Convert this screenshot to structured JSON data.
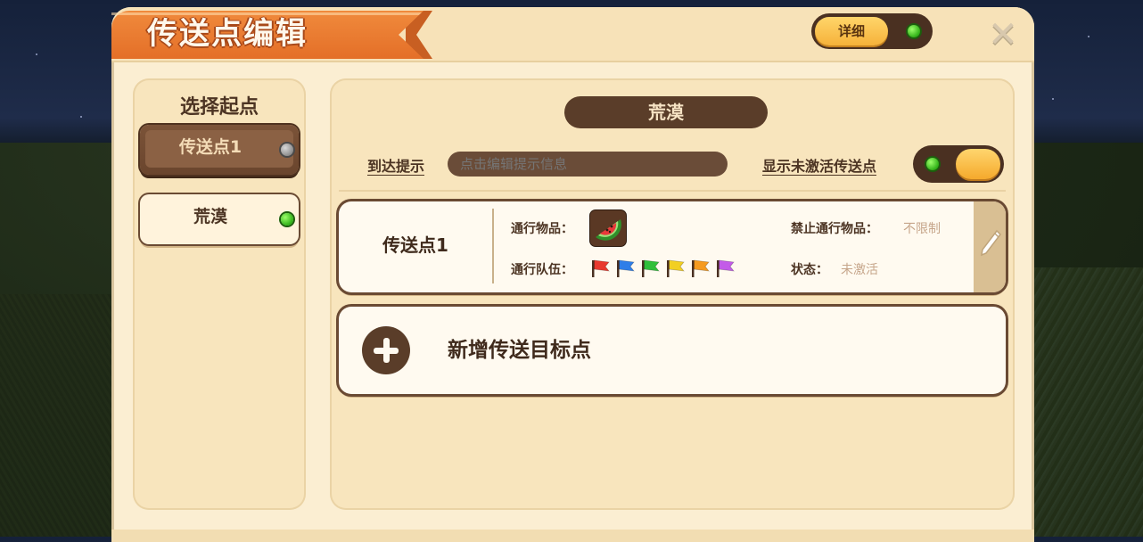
{
  "header": {
    "title": "传送点编辑",
    "detail_label": "详细",
    "close_icon": "close-x-icon"
  },
  "left_panel": {
    "title": "选择起点",
    "items": [
      {
        "label": "传送点1",
        "state": "selected",
        "indicator": "grey"
      },
      {
        "label": "荒漠",
        "state": "normal",
        "indicator": "green"
      }
    ]
  },
  "right_panel": {
    "map_name": "荒漠",
    "arrive_hint_label": "到达提示",
    "arrive_hint_placeholder": "点击编辑提示信息",
    "show_inactive_label": "显示未激活传送点",
    "show_inactive_enabled": true,
    "teleport_card": {
      "name": "传送点1",
      "pass_items_label": "通行物品：",
      "pass_item_icon": "watermelon-slice-icon",
      "pass_team_label": "通行队伍：",
      "team_flags": [
        {
          "name": "red-flag-icon",
          "color": "#e8392f"
        },
        {
          "name": "blue-flag-icon",
          "color": "#2f7ee8"
        },
        {
          "name": "green-flag-icon",
          "color": "#2fbf3a"
        },
        {
          "name": "yellow-flag-icon",
          "color": "#f2cf22"
        },
        {
          "name": "orange-flag-icon",
          "color": "#f59a1f"
        },
        {
          "name": "purple-flag-icon",
          "color": "#c35be8"
        }
      ],
      "forbidden_items_label": "禁止通行物品：",
      "forbidden_items_value": "不限制",
      "status_label": "状态：",
      "status_value": "未激活"
    },
    "add_target_label": "新增传送目标点"
  },
  "colors": {
    "accent_orange": "#e97a30",
    "panel_bg": "#f8e5bd",
    "dark_brown": "#5a3d29",
    "active_green": "#2fb017"
  }
}
